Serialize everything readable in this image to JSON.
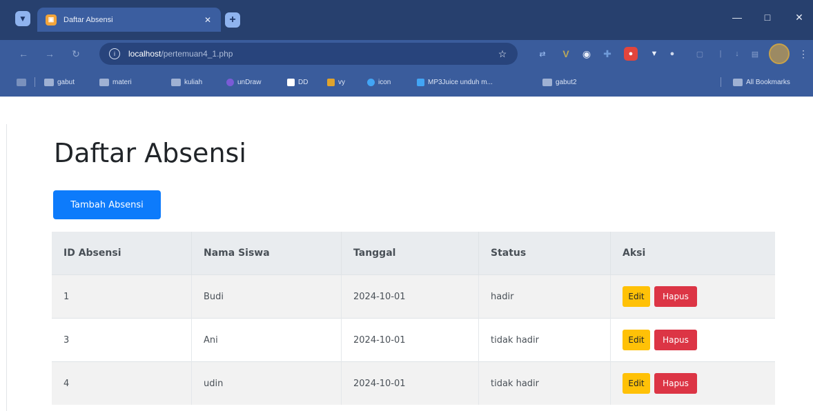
{
  "browser": {
    "tab_title": "Daftar Absensi",
    "url_host": "localhost",
    "url_path": "/pertemuan4_1.php",
    "bookmarks": [
      "gabut",
      "materi",
      "kuliah",
      "unDraw",
      "DD",
      "vy",
      "icon",
      "MP3Juice unduh m...",
      "gabut2"
    ],
    "all_bookmarks_label": "All Bookmarks"
  },
  "page": {
    "title": "Daftar Absensi",
    "add_button": "Tambah Absensi"
  },
  "table": {
    "headers": [
      "ID Absensi",
      "Nama Siswa",
      "Tanggal",
      "Status",
      "Aksi"
    ],
    "rows": [
      {
        "id": "1",
        "nama": "Budi",
        "tanggal": "2024-10-01",
        "status": "hadir"
      },
      {
        "id": "3",
        "nama": "Ani",
        "tanggal": "2024-10-01",
        "status": "tidak hadir"
      },
      {
        "id": "4",
        "nama": "udin",
        "tanggal": "2024-10-01",
        "status": "tidak hadir"
      }
    ],
    "edit_label": "Edit",
    "delete_label": "Hapus"
  },
  "colors": {
    "primary": "#0d7bfb",
    "warning": "#ffc107",
    "danger": "#dc3545",
    "browser_frame": "#27406e"
  }
}
